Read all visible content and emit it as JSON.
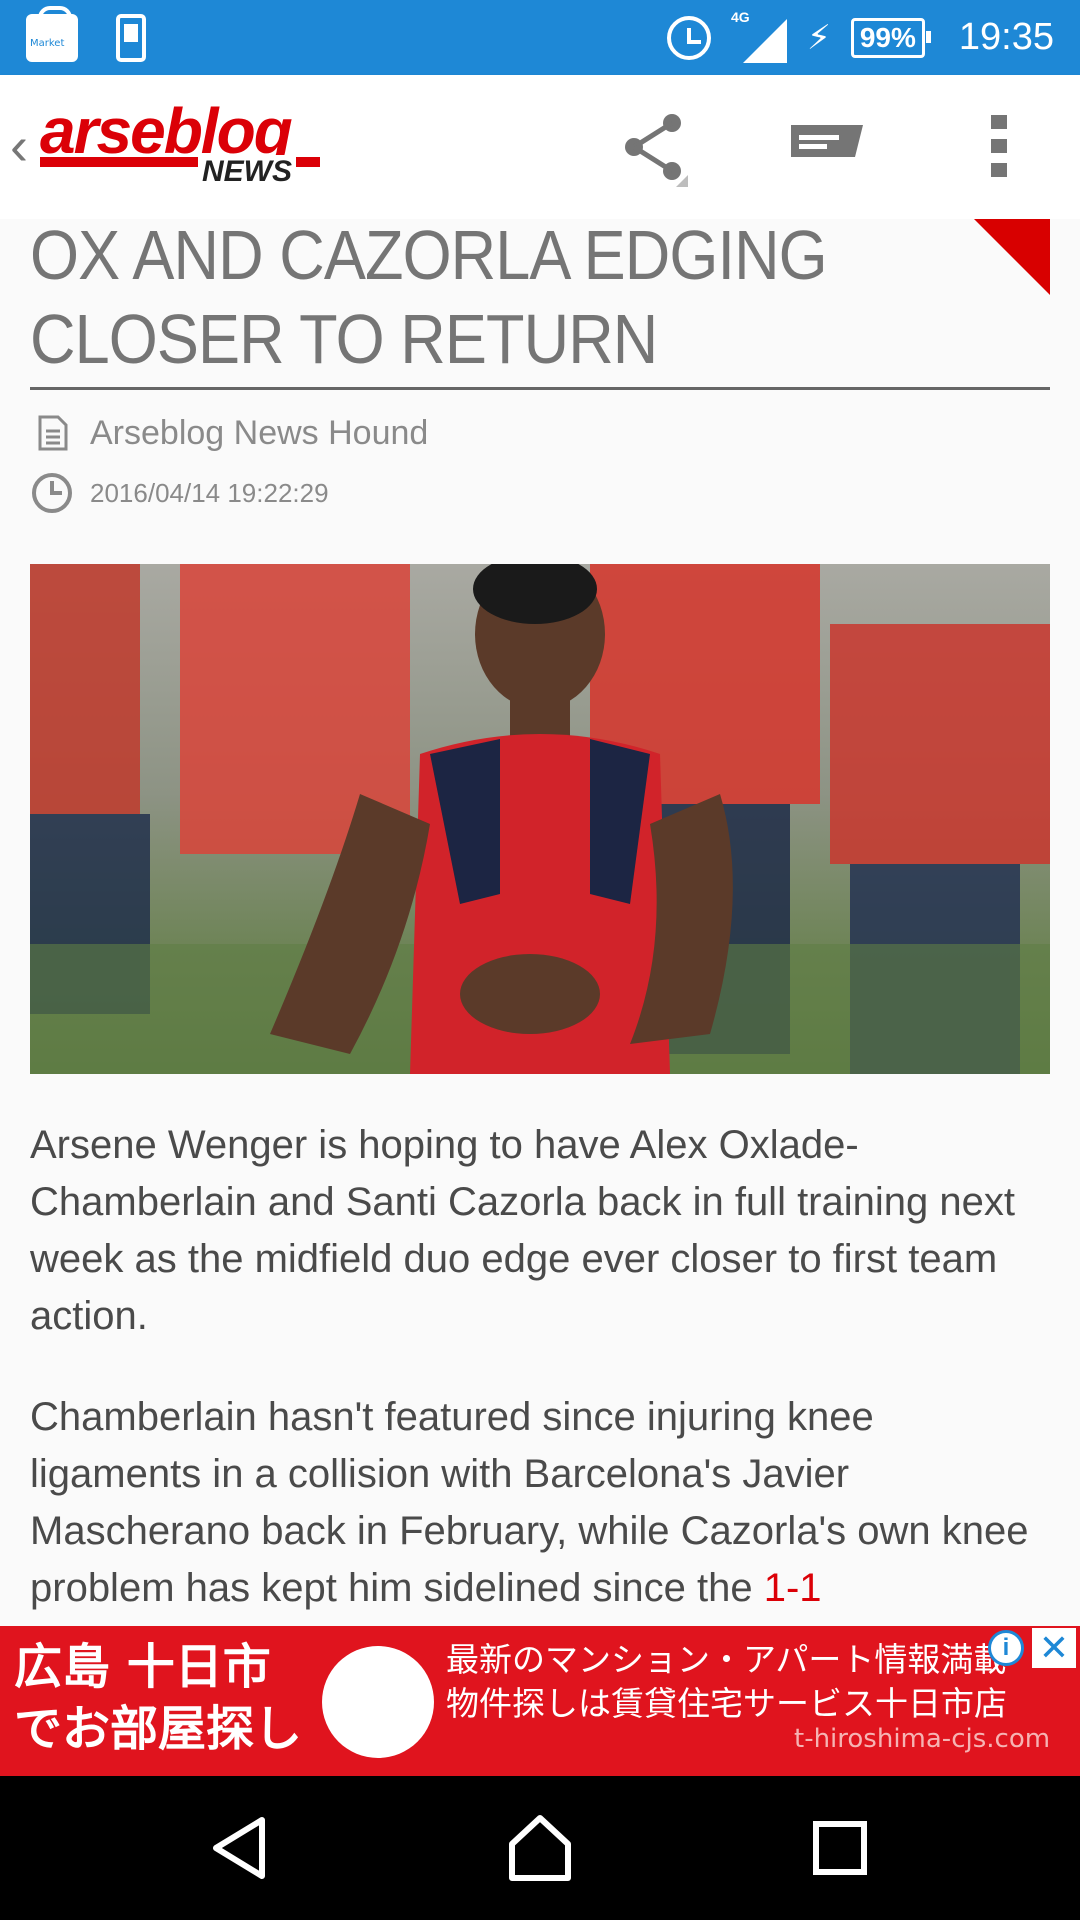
{
  "status_bar": {
    "market_label": "Market",
    "network_type": "4G",
    "battery": "99%",
    "time": "19:35"
  },
  "app_bar": {
    "logo_main": "arseblog",
    "logo_sub": "NEWS",
    "actions": [
      "share-icon",
      "comment-icon",
      "more-vert-icon"
    ]
  },
  "article": {
    "title_line1": "OX AND CAZORLA EDGING",
    "title_line2": "CLOSER TO RETURN",
    "author": "Arseblog News Hound",
    "date": "2016/04/14 19:22:29",
    "paragraph1": "Arsene Wenger is hoping to have Alex Oxlade-Chamberlain and Santi Cazorla back in full training next week as the midfield duo edge ever closer to first team action.",
    "paragraph2_text": "Chamberlain hasn't featured since injuring knee ligaments in a collision with Barcelona's Javier Mascherano back in February, while Cazorla's own knee problem has kept him sidelined since the ",
    "paragraph2_link": "1-1"
  },
  "ad": {
    "left_line1": "広島 十日市",
    "left_line2": "でお部屋探し",
    "right_line1": "最新のマンション・アパート情報満載",
    "right_line2": "物件探しは賃貸住宅サービス十日市店",
    "domain": "t-hiroshima-cjs.com"
  },
  "colors": {
    "status_bar": "#1e88d6",
    "brand_red": "#db0007",
    "ad_red": "#e0141e",
    "text_gray": "#4a4a4a"
  }
}
